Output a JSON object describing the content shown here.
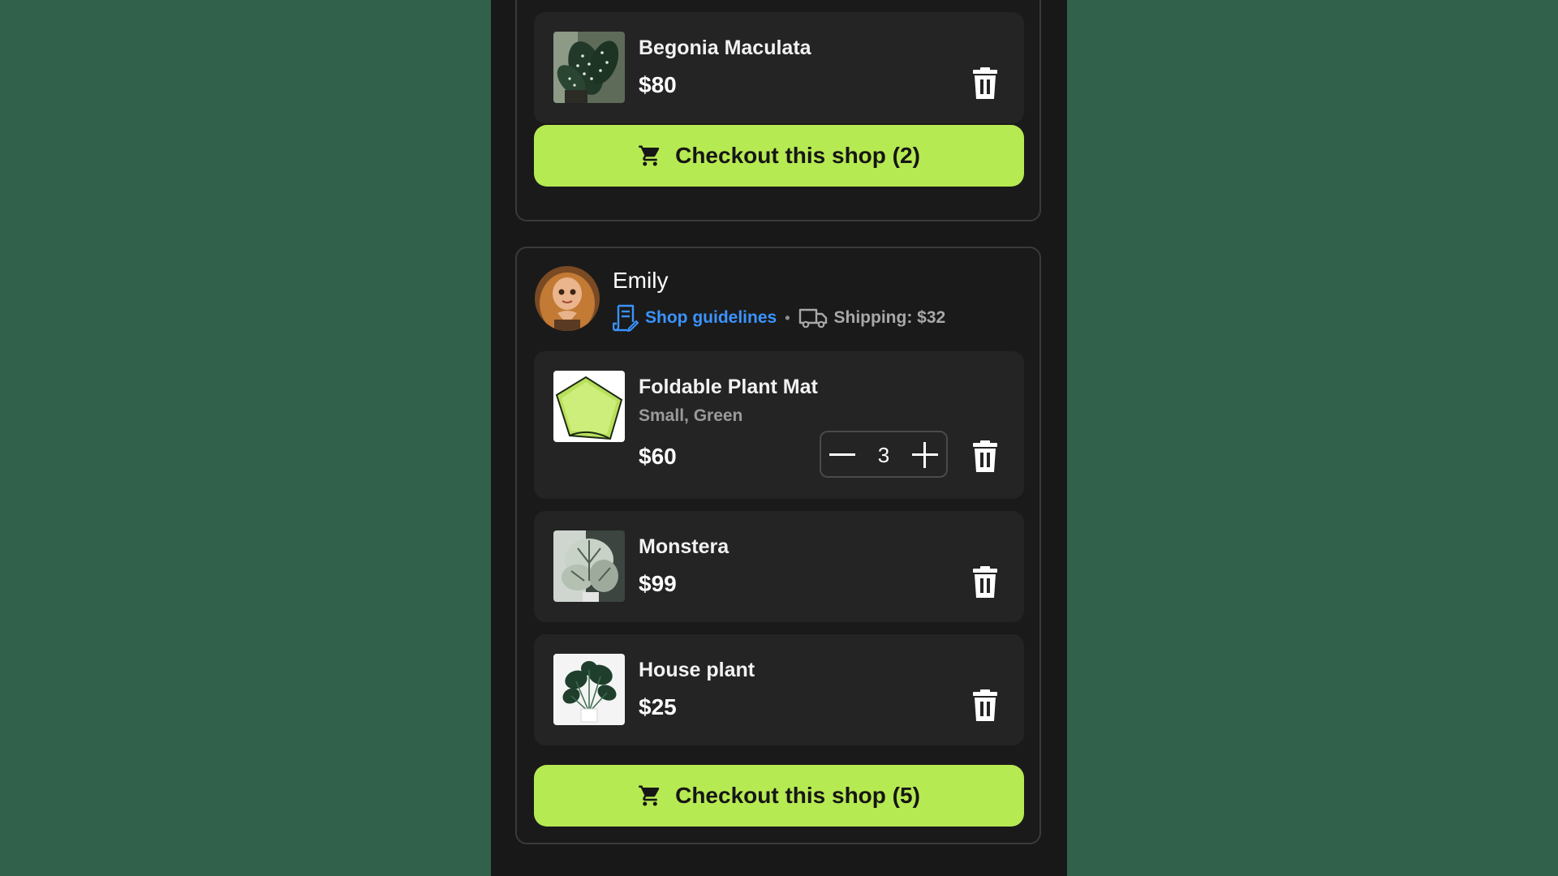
{
  "shops": [
    {
      "items": [
        {
          "name": "Begonia Maculata",
          "price": "$80",
          "thumb_icon": "begonia-photo"
        }
      ],
      "checkout_label": "Checkout this shop (2)"
    },
    {
      "seller_name": "Emily",
      "guidelines_label": "Shop guidelines",
      "separator": "•",
      "shipping_label": "Shipping: $32",
      "items": [
        {
          "name": "Foldable Plant Mat",
          "variant": "Small, Green",
          "price": "$60",
          "quantity": "3",
          "thumb_icon": "plant-mat-photo"
        },
        {
          "name": "Monstera",
          "price": "$99",
          "thumb_icon": "monstera-photo"
        },
        {
          "name": "House plant",
          "price": "$25",
          "thumb_icon": "house-plant-photo"
        }
      ],
      "checkout_label": "Checkout this shop (5)"
    }
  ],
  "colors": {
    "accent": "#b6ea52",
    "link": "#3b93ff",
    "page_background": "#31614a",
    "card_background": "#242424"
  }
}
